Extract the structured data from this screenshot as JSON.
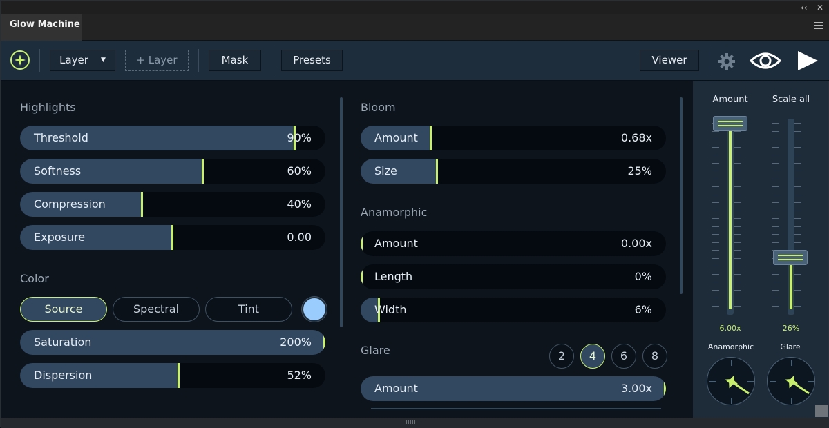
{
  "window": {
    "minimize_glyph": "‹‹",
    "close_glyph": "✕",
    "tab_title": "Glow Machine"
  },
  "toolbar": {
    "layer_select": "Layer",
    "layer_add": "+ Layer",
    "mask": "Mask",
    "presets": "Presets",
    "viewer": "Viewer"
  },
  "highlights": {
    "title": "Highlights",
    "sliders": [
      {
        "label": "Threshold",
        "value": "90%",
        "level": 0.9
      },
      {
        "label": "Softness",
        "value": "60%",
        "level": 0.6
      },
      {
        "label": "Compression",
        "value": "40%",
        "level": 0.4
      },
      {
        "label": "Exposure",
        "value": "0.00",
        "level": 0.5
      }
    ]
  },
  "color": {
    "title": "Color",
    "modes": [
      "Source",
      "Spectral",
      "Tint"
    ],
    "selected_mode": "Source",
    "swatch_color": "#9acdfd",
    "sliders": [
      {
        "label": "Saturation",
        "value": "200%",
        "level": 1.0
      },
      {
        "label": "Dispersion",
        "value": "52%",
        "level": 0.52
      }
    ]
  },
  "bloom": {
    "title": "Bloom",
    "sliders": [
      {
        "label": "Amount",
        "value": "0.68x",
        "level": 0.23
      },
      {
        "label": "Size",
        "value": "25%",
        "level": 0.25
      }
    ]
  },
  "anamorphic": {
    "title": "Anamorphic",
    "sliders": [
      {
        "label": "Amount",
        "value": "0.00x",
        "level": 0.0
      },
      {
        "label": "Length",
        "value": "0%",
        "level": 0.0
      },
      {
        "label": "Width",
        "value": "6%",
        "level": 0.06
      }
    ]
  },
  "glare": {
    "title": "Glare",
    "options": [
      "2",
      "4",
      "6",
      "8"
    ],
    "selected": "4",
    "sliders": [
      {
        "label": "Amount",
        "value": "3.00x",
        "level": 1.0
      }
    ]
  },
  "master": {
    "amount": {
      "label": "Amount",
      "value": "6.00x",
      "level": 1.0
    },
    "scale_all": {
      "label": "Scale all",
      "value": "26%",
      "level": 0.26
    },
    "knobs": [
      {
        "label": "Anamorphic"
      },
      {
        "label": "Glare"
      }
    ]
  },
  "colors": {
    "accent": "#c8f06e",
    "fill": "#314860",
    "track": "#050a10",
    "toolbar": "#1e2d3c"
  }
}
